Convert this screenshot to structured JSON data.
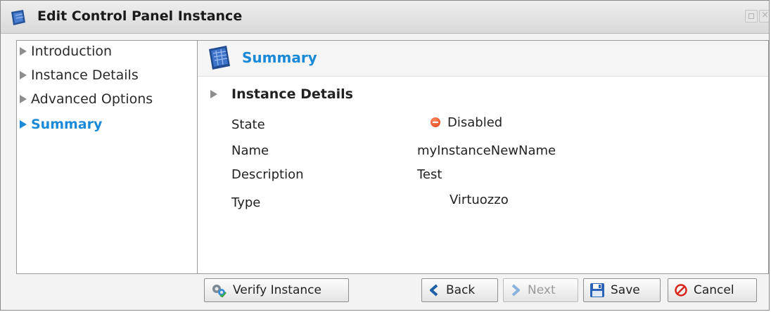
{
  "window": {
    "title": "Edit Control Panel Instance"
  },
  "nav": {
    "items": [
      {
        "label": "Introduction"
      },
      {
        "label": "Instance Details"
      },
      {
        "label": "Advanced Options"
      },
      {
        "label": "Summary",
        "active": true
      }
    ]
  },
  "main": {
    "header_title": "Summary",
    "section_title": "Instance Details",
    "fields": [
      {
        "label": "State",
        "value": "Disabled"
      },
      {
        "label": "Name",
        "value": "myInstanceNewName"
      },
      {
        "label": "Description",
        "value": "Test"
      },
      {
        "label": "Type",
        "value": "Virtuozzo"
      }
    ]
  },
  "footer": {
    "verify_label": "Verify Instance",
    "back_label": "Back",
    "next_label": "Next",
    "save_label": "Save",
    "cancel_label": "Cancel"
  },
  "colors": {
    "accent": "#1a8ad8",
    "state_disabled": "#e13d14",
    "cancel_red": "#d9241b"
  }
}
